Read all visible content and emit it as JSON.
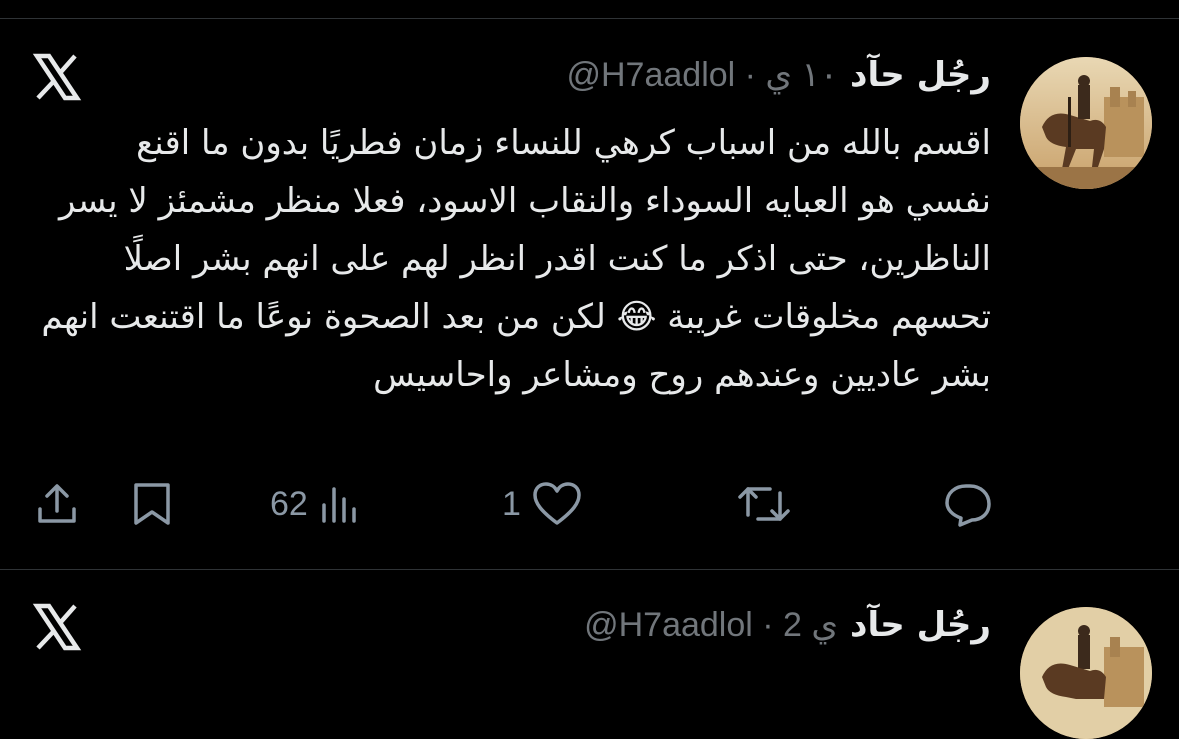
{
  "tweets": [
    {
      "display_name": "رجُل حآد",
      "handle_line": "@H7aadlol · ١٠ ي",
      "text": "اقسم بالله من اسباب كرهي للنساء زمان فطريًا بدون ما اقنع نفسي هو العبايه السوداء والنقاب الاسود، فعلا منظر مشمئز لا يسر الناظرين، حتى اذكر ما كنت اقدر انظر لهم على انهم بشر اصلًا تحسهم مخلوقات غريبة 😂 لكن من بعد الصحوة نوعًا ما اقتنعت انهم بشر عاديين وعندهم روح ومشاعر واحاسيس",
      "views": "62",
      "likes": "1",
      "retweets": "",
      "replies": ""
    },
    {
      "display_name": "رجُل حآد",
      "handle_line": "@H7aadlol · 2 ي"
    }
  ],
  "icons": {
    "logo": "x-logo-icon",
    "share": "share-icon",
    "bookmark": "bookmark-icon",
    "views": "views-chart-icon",
    "like": "heart-icon",
    "retweet": "retweet-icon",
    "reply": "reply-icon"
  },
  "colors": {
    "background": "#000000",
    "text": "#e7e9ea",
    "muted": "#71767b",
    "divider": "#2f3336"
  }
}
